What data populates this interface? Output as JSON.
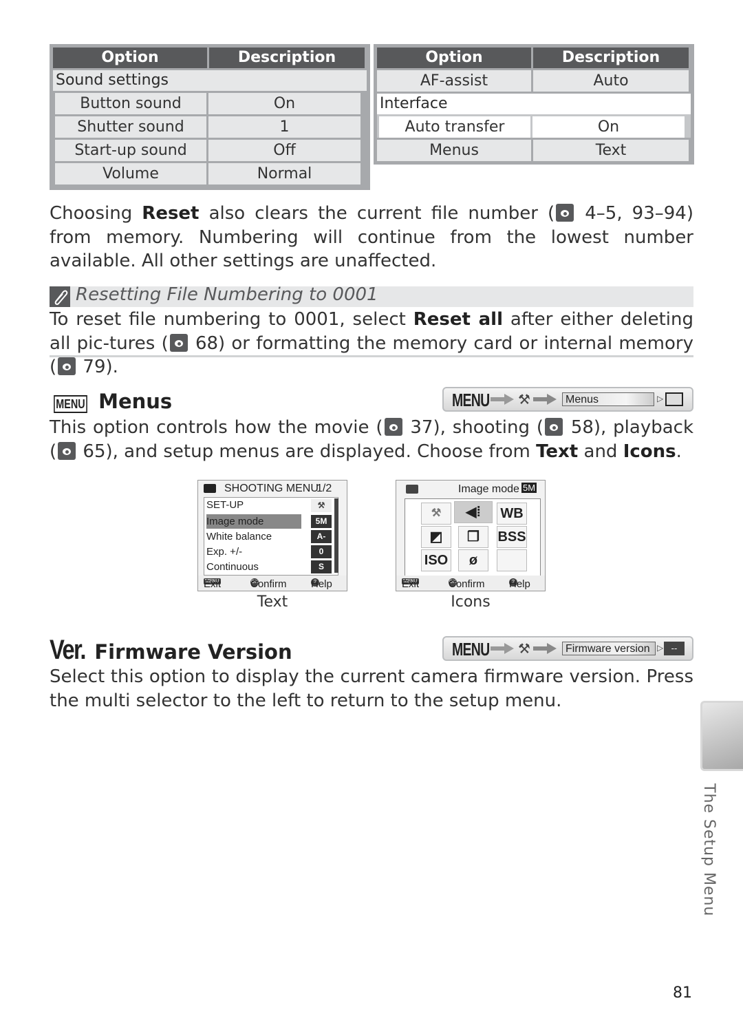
{
  "table_left": {
    "headers": [
      "Option",
      "Description"
    ],
    "group": "Sound settings",
    "rows": [
      {
        "option": "Button sound",
        "description": "On"
      },
      {
        "option": "Shutter sound",
        "description": "1"
      },
      {
        "option": "Start-up sound",
        "description": "Off"
      },
      {
        "option": "Volume",
        "description": "Normal"
      }
    ]
  },
  "table_right": {
    "headers": [
      "Option",
      "Description"
    ],
    "rows_top": [
      {
        "option": "AF-assist",
        "description": "Auto"
      }
    ],
    "group": "Interface",
    "group_rows": [
      {
        "option": "Auto transfer",
        "description": "On"
      }
    ],
    "rows_bottom": [
      {
        "option": "Menus",
        "description": "Text"
      }
    ]
  },
  "reset_para": {
    "t1": "Choosing ",
    "b1": "Reset",
    "t2": " also clears the current file number (",
    "t3": " 4–5, 93–94) from memory.  Numbering will continue from the lowest number available.  All other settings are unaffected."
  },
  "note": {
    "title": "Resetting File Numbering to 0001",
    "t1": "To reset file numbering to 0001, select ",
    "b1": "Reset all",
    "t2": " after either deleting all pic-tures  (",
    "t3": " 68) or formatting the memory card or internal memory (",
    "t4": " 79)."
  },
  "menus_section": {
    "icon": "MENU",
    "title": "Menus",
    "path": {
      "menu": "MENU",
      "field": "Menus"
    },
    "t1": "This option controls how the movie (",
    "t2": " 37), shooting (",
    "t3": " 58), playback (",
    "t4": " 65), and setup menus are displayed.  Choose from ",
    "b1": "Text",
    "t5": " and ",
    "b2": "Icons",
    "t6": "."
  },
  "screen_text": {
    "title": "SHOOTING MENU",
    "page": "1/2",
    "items": [
      {
        "label": "SET-UP",
        "value": ""
      },
      {
        "label": "Image mode",
        "value": "5M"
      },
      {
        "label": "White balance",
        "value": "A-WB"
      },
      {
        "label": "Exp. +/-",
        "value": "0"
      },
      {
        "label": "Continuous",
        "value": "S"
      }
    ],
    "footer": {
      "exit": "Exit",
      "confirm": "Confirm",
      "help": "Help"
    },
    "caption": "Text"
  },
  "screen_icons": {
    "title": "Image mode",
    "badge": "5M",
    "cells": [
      "wrench",
      "image-mode",
      "WB",
      "exp",
      "continuous",
      "BSS",
      "ISO",
      "color",
      ""
    ],
    "footer": {
      "exit": "Exit",
      "confirm": "Confirm",
      "help": "Help"
    },
    "caption": "Icons"
  },
  "firmware_section": {
    "prefix": "Ver.",
    "title": "Firmware Version",
    "path": {
      "menu": "MENU",
      "field": "Firmware version",
      "value": "--"
    },
    "body": "Select this option to display the current camera firmware version.  Press the multi selector to the left to return to the setup menu."
  },
  "side_label": "The Setup Menu",
  "page_number": "81"
}
